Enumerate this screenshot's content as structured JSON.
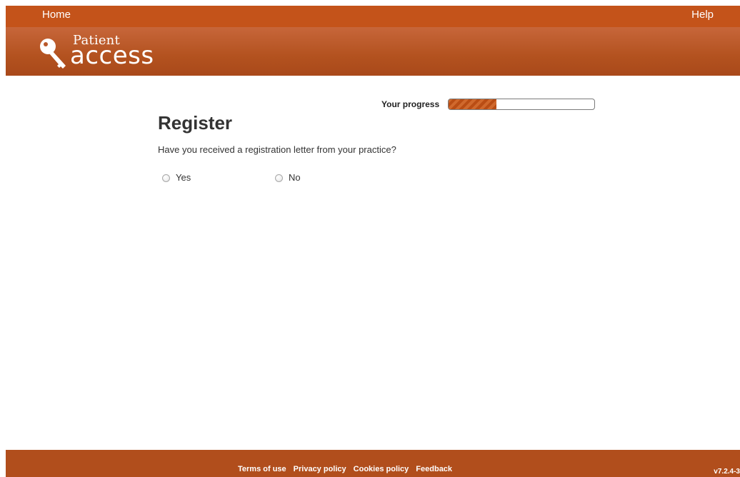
{
  "nav": {
    "home_label": "Home",
    "help_label": "Help"
  },
  "logo": {
    "small_text": "Patient",
    "big_text": "access",
    "icon": "key-icon"
  },
  "progress": {
    "label": "Your progress",
    "fraction": 0.33
  },
  "register": {
    "title": "Register",
    "question": "Have you received a registration letter from your practice?",
    "options": [
      {
        "label": "Yes",
        "selected": false
      },
      {
        "label": "No",
        "selected": false
      }
    ]
  },
  "footer": {
    "links": [
      "Terms of use",
      "Privacy policy",
      "Cookies policy",
      "Feedback"
    ],
    "version": "v7.2.4-3"
  },
  "colors": {
    "brand_orange": "#c4531a",
    "footer_orange": "#b14e1c",
    "progress_fill": "#c85a1c"
  }
}
